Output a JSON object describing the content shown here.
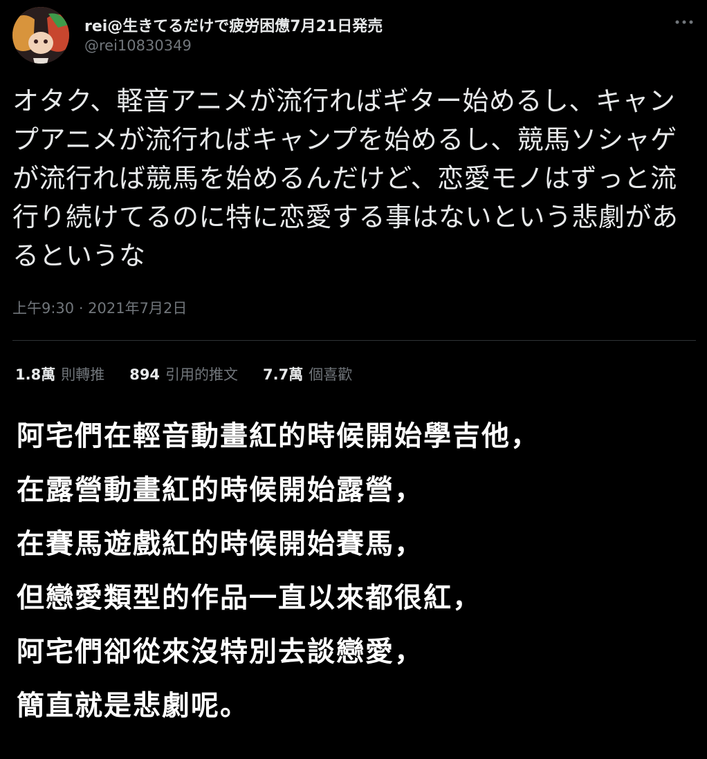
{
  "tweet": {
    "display_name": "rei@生きてるだけで疲労困憊7月21日発売",
    "handle": "@rei10830349",
    "text": "オタク、軽音アニメが流行ればギター始めるし、キャンプアニメが流行ればキャンプを始めるし、競馬ソシャゲが流行れば競馬を始めるんだけど、恋愛モノはずっと流行り続けてるのに特に恋愛する事はないという悲劇があるというな",
    "timestamp": "上午9:30 · 2021年7月2日",
    "icons": {
      "avatar": "user-avatar",
      "more": "more-options-icon"
    }
  },
  "stats": [
    {
      "number": "1.8萬",
      "label": "則轉推"
    },
    {
      "number": "894",
      "label": "引用的推文"
    },
    {
      "number": "7.7萬",
      "label": "個喜歡"
    }
  ],
  "translation": {
    "lines": [
      "阿宅們在輕音動畫紅的時候開始學吉他，",
      "在露營動畫紅的時候開始露營，",
      "在賽馬遊戲紅的時候開始賽馬，",
      "但戀愛類型的作品一直以來都很紅，",
      "阿宅們卻從來沒特別去談戀愛，",
      "簡直就是悲劇呢。"
    ]
  },
  "colors": {
    "background": "#000000",
    "primary_text": "#e7e9ea",
    "secondary_text": "#71767b",
    "divider": "#2f3336",
    "caption_text": "#ffffff"
  }
}
